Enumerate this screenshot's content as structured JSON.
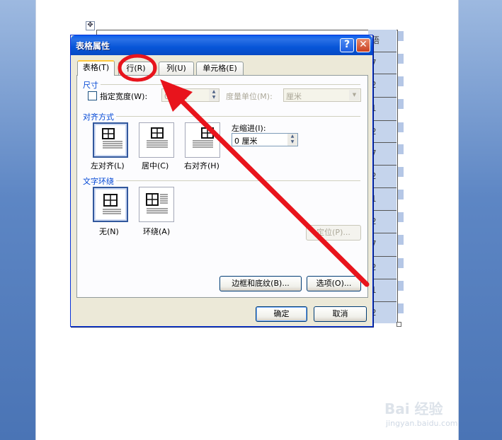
{
  "document": {
    "table_right_column": [
      "语",
      "7",
      "2",
      "1",
      "2",
      "7",
      "2",
      "1",
      "2",
      "7",
      "2",
      "1",
      "2"
    ]
  },
  "dialog": {
    "title": "表格属性",
    "help_symbol": "?",
    "close_symbol": "✕",
    "tabs": [
      {
        "label": "表格(T)",
        "active": true
      },
      {
        "label": "行(R)",
        "active": false
      },
      {
        "label": "列(U)",
        "active": false
      },
      {
        "label": "单元格(E)",
        "active": false
      }
    ],
    "size_section": {
      "title": "尺寸",
      "specify_width_label": "指定宽度(W):",
      "specify_width_checked": false,
      "width_value": "0 厘米",
      "unit_label": "度量单位(M):",
      "unit_value": "厘米"
    },
    "alignment_section": {
      "title": "对齐方式",
      "options": [
        "左对齐(L)",
        "居中(C)",
        "右对齐(H)"
      ],
      "selected": "左对齐(L)",
      "indent_label": "左缩进(I):",
      "indent_value": "0 厘米"
    },
    "wrap_section": {
      "title": "文字环绕",
      "options": [
        "无(N)",
        "环绕(A)"
      ],
      "selected": "无(N)",
      "position_button": "定位(P)..."
    },
    "borders_button": "边框和底纹(B)...",
    "options_button": "选项(O)...",
    "ok_button": "确定",
    "cancel_button": "取消"
  },
  "annotation": {
    "color": "#e8141c",
    "highlight": "circle around the 行(R) tab with arrow pointing to it"
  },
  "watermark": {
    "brand": "Bai 经验",
    "url": "jingyan.baidu.com"
  }
}
